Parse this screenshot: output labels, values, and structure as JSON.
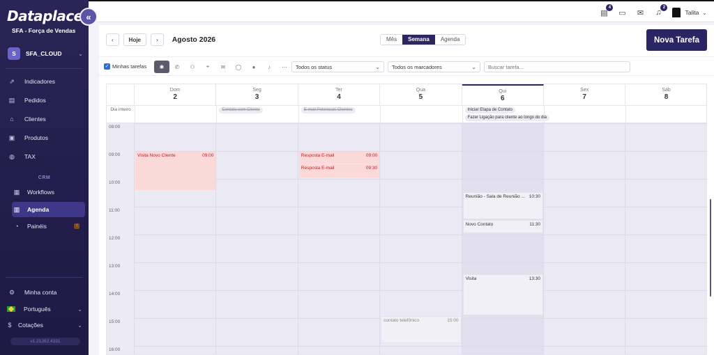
{
  "sidebar": {
    "logo": "Dataplace",
    "subtitle": "SFA - Força de Vendas",
    "collapse_glyph": "«",
    "tenant": {
      "initial": "S",
      "name": "SFA_CLOUD"
    },
    "items": [
      {
        "label": "Indicadores",
        "icon": "chart-line-icon"
      },
      {
        "label": "Pedidos",
        "icon": "document-icon"
      },
      {
        "label": "Clientes",
        "icon": "store-icon"
      },
      {
        "label": "Produtos",
        "icon": "box-icon"
      },
      {
        "label": "TAX",
        "icon": "globe-icon"
      }
    ],
    "section_label": "CRM",
    "crm_items": [
      {
        "label": "Workflows",
        "icon": "board-icon"
      },
      {
        "label": "Agenda",
        "icon": "calendar-icon",
        "active": true
      },
      {
        "label": "Painéis",
        "icon": "pie-chart-icon",
        "badge": "!"
      }
    ],
    "bottom": {
      "account": "Minha conta",
      "language": "Português",
      "quotes": "Cotações",
      "version": "v1.21262.4331"
    }
  },
  "topbar": {
    "counts": {
      "tasks": "4",
      "notifications": "2"
    },
    "user": "Talita"
  },
  "toolbar": {
    "prev": "‹",
    "today": "Hoje",
    "next": "›",
    "title": "Agosto 2026",
    "views": [
      "Mês",
      "Semana",
      "Agenda"
    ],
    "active_view": "Semana",
    "new_task": "Nova Tarefa"
  },
  "filters": {
    "my_tasks": "Minhas tarefas",
    "status": "Todos os status",
    "markers": "Todos os marcadores",
    "search_placeholder": "Buscar tarefa..."
  },
  "calendar": {
    "allday_label": "Dia inteiro",
    "days": [
      {
        "name": "Dom",
        "num": "2"
      },
      {
        "name": "Seg",
        "num": "3"
      },
      {
        "name": "Ter",
        "num": "4"
      },
      {
        "name": "Qua",
        "num": "5"
      },
      {
        "name": "Qui",
        "num": "6",
        "today": true
      },
      {
        "name": "Sex",
        "num": "7"
      },
      {
        "name": "Sáb",
        "num": "8"
      }
    ],
    "hours": [
      "08:00",
      "09:00",
      "10:00",
      "11:00",
      "12:00",
      "13:00",
      "14:00",
      "15:00",
      "16:00"
    ],
    "allday_events": [
      {
        "day": 1,
        "row": 0,
        "title": "Contato com Cliente",
        "done": true
      },
      {
        "day": 2,
        "row": 0,
        "title": "E-mail Potenciais Clientes",
        "done": true
      },
      {
        "day": 4,
        "row": 0,
        "title": "Iniciar Etapa de Contato",
        "done": false
      },
      {
        "day": 4,
        "row": 1,
        "title": "Fazer Ligação para cliente ao longo do dia",
        "done": false
      }
    ],
    "events": [
      {
        "day": 0,
        "title": "Visita Novo Cliente",
        "time": "09:00",
        "start": 9.0,
        "end": 10.4,
        "style": "red"
      },
      {
        "day": 2,
        "title": "Resposta E-mail",
        "time": "09:00",
        "start": 9.0,
        "end": 9.45,
        "style": "red"
      },
      {
        "day": 2,
        "title": "Resposta E-mail",
        "time": "09:30",
        "start": 9.45,
        "end": 9.95,
        "style": "red"
      },
      {
        "day": 4,
        "title": "Reunião - Sala de Reunião ...",
        "time": "10:30",
        "start": 10.45,
        "end": 11.45,
        "style": "gray"
      },
      {
        "day": 4,
        "title": "Novo Contato",
        "time": "11:30",
        "start": 11.45,
        "end": 11.95,
        "style": "gray"
      },
      {
        "day": 4,
        "title": "Visita",
        "time": "13:30",
        "start": 13.4,
        "end": 14.9,
        "style": "gray"
      },
      {
        "day": 3,
        "title": "contato telefônico",
        "time": "15:00",
        "start": 14.9,
        "end": 15.9,
        "style": "muted"
      }
    ]
  }
}
